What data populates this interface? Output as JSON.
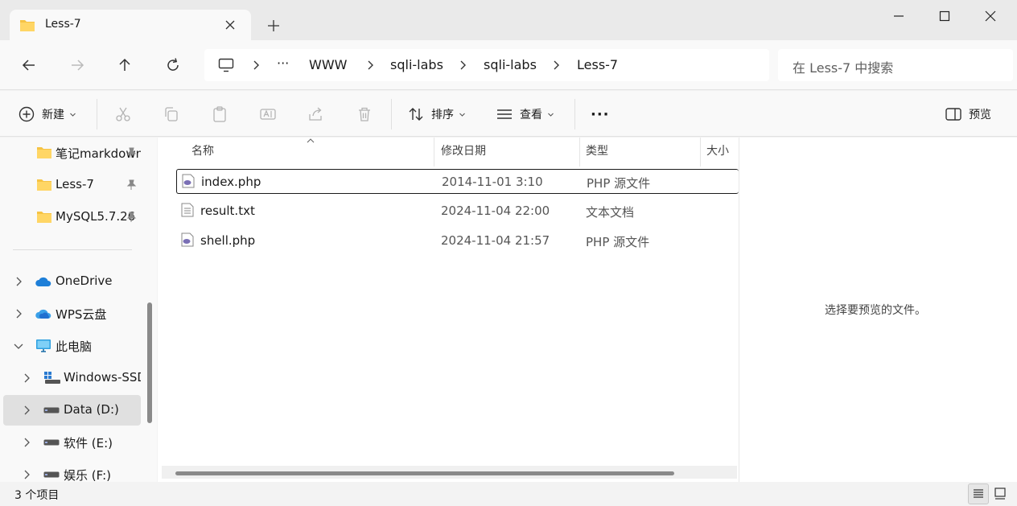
{
  "window": {
    "tab_title": "Less-7",
    "new_tab_symbol": "+"
  },
  "address_bar": {
    "overflow": "···",
    "breadcrumbs": [
      "WWW",
      "sqli-labs",
      "sqli-labs",
      "Less-7"
    ]
  },
  "search": {
    "placeholder": "在 Less-7 中搜索"
  },
  "toolbar": {
    "new_label": "新建",
    "sort_label": "排序",
    "view_label": "查看",
    "more_label": "···",
    "preview_label": "预览"
  },
  "sidebar": {
    "quick_access": [
      {
        "label": "笔记markdown",
        "pinned": true
      },
      {
        "label": "Less-7",
        "pinned": true
      },
      {
        "label": "MySQL5.7.26",
        "pinned": true
      }
    ],
    "items": [
      {
        "label": "OneDrive",
        "expanded": false
      },
      {
        "label": "WPS云盘",
        "expanded": false
      },
      {
        "label": "此电脑",
        "expanded": true
      },
      {
        "label": "Windows-SSD",
        "expanded": false
      },
      {
        "label": "Data (D:)",
        "expanded": false,
        "selected": true
      },
      {
        "label": "软件 (E:)",
        "expanded": false
      },
      {
        "label": "娱乐 (F:)",
        "expanded": false
      }
    ]
  },
  "file_list": {
    "columns": {
      "name": "名称",
      "date": "修改日期",
      "type": "类型",
      "size": "大小"
    },
    "files": [
      {
        "name": "index.php",
        "date": "2014-11-01 3:10",
        "type": "PHP 源文件",
        "icon": "php-file-icon"
      },
      {
        "name": "result.txt",
        "date": "2024-11-04 22:00",
        "type": "文本文档",
        "icon": "text-file-icon"
      },
      {
        "name": "shell.php",
        "date": "2024-11-04 21:57",
        "type": "PHP 源文件",
        "icon": "php-file-icon"
      }
    ]
  },
  "preview": {
    "empty_text": "选择要预览的文件。"
  },
  "status": {
    "item_count": "3 个项目"
  },
  "colors": {
    "folder": "#f6c344",
    "onedrive": "#1e7fd8",
    "pc": "#2ea0e0",
    "php": "#7a6fb5"
  }
}
